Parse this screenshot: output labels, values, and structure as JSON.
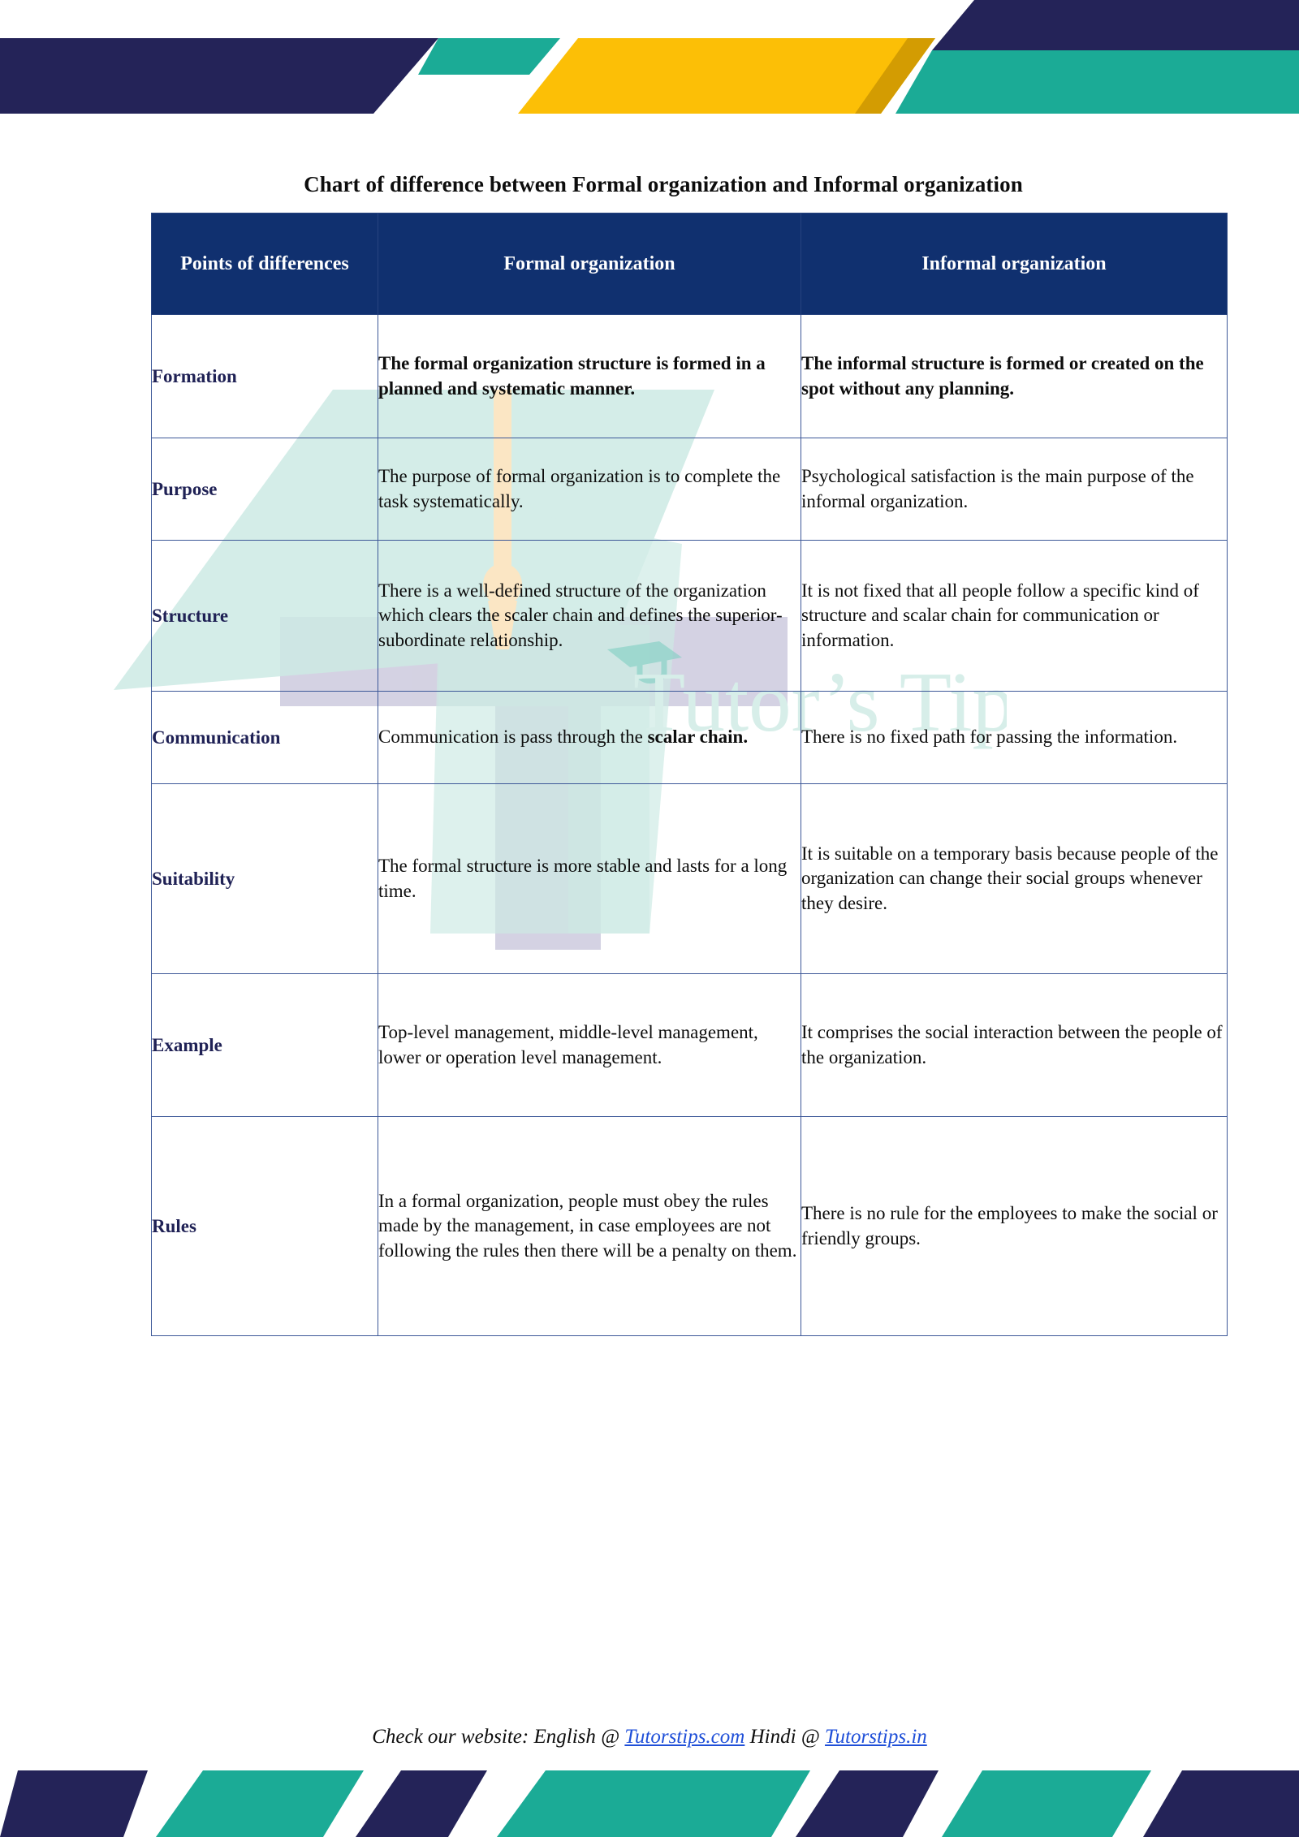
{
  "document": {
    "title": "Chart of difference between Formal organization and Informal organization"
  },
  "table": {
    "headers": {
      "points": "Points of differences",
      "formal": "Formal organization",
      "informal": "Informal organization"
    },
    "rows": [
      {
        "label": "Formation",
        "formal": "The formal organization structure is formed in a planned and systematic manner.",
        "informal": "The informal structure is formed or created on the spot without any planning.",
        "bold": true
      },
      {
        "label": "Purpose",
        "formal": "The purpose of formal organization is to complete the task systematically.",
        "informal": "Psychological satisfaction is the main purpose of the informal organization.",
        "bold": false
      },
      {
        "label": "Structure",
        "formal": "There is a well-defined structure of the organization which clears the scaler chain and defines the superior-subordinate relationship.",
        "informal": "It is not fixed that all people follow a specific kind of structure and scalar chain for communication or information.",
        "bold": false
      },
      {
        "label": "Communication",
        "formal_prefix": "Communication is pass through the ",
        "formal_bold": "scalar chain.",
        "informal": "There is no fixed path for passing the information.",
        "bold": false
      },
      {
        "label": "Suitability",
        "formal": "The formal structure is more stable and lasts for a long time.",
        "informal": "It is suitable on a temporary basis because people of the organization can change their social groups whenever they desire.",
        "bold": false
      },
      {
        "label": "Example",
        "formal": "Top-level management, middle-level management, lower or operation level management.",
        "informal": "It comprises the social interaction between the people of the organization.",
        "bold": false
      },
      {
        "label": "Rules",
        "formal": "In a formal organization, people must obey the rules made by the management, in case employees are not following the rules then there will be a penalty on them.",
        "informal": "There is no rule for the employees to make the social or friendly groups.",
        "bold": false
      }
    ]
  },
  "footer": {
    "intro": "Check our website: English @ ",
    "link_english": "Tutorstips.com",
    "middle": " Hindi @ ",
    "link_hindi": "Tutorstips.in"
  },
  "watermark": {
    "brand": "Tutor's Tips"
  },
  "colors": {
    "navy": "#242358",
    "teal": "#1bab96",
    "yellow": "#fcbf06",
    "yellow_dark": "#d39c02",
    "header_blue": "#10306f",
    "border_blue": "#3d5898",
    "label_navy": "#1f2155",
    "link_blue": "#1f4fd8",
    "watermark_mint": "#cdeae4",
    "watermark_lavender": "#c4c1d8",
    "watermark_cream": "#fbe6c4"
  }
}
